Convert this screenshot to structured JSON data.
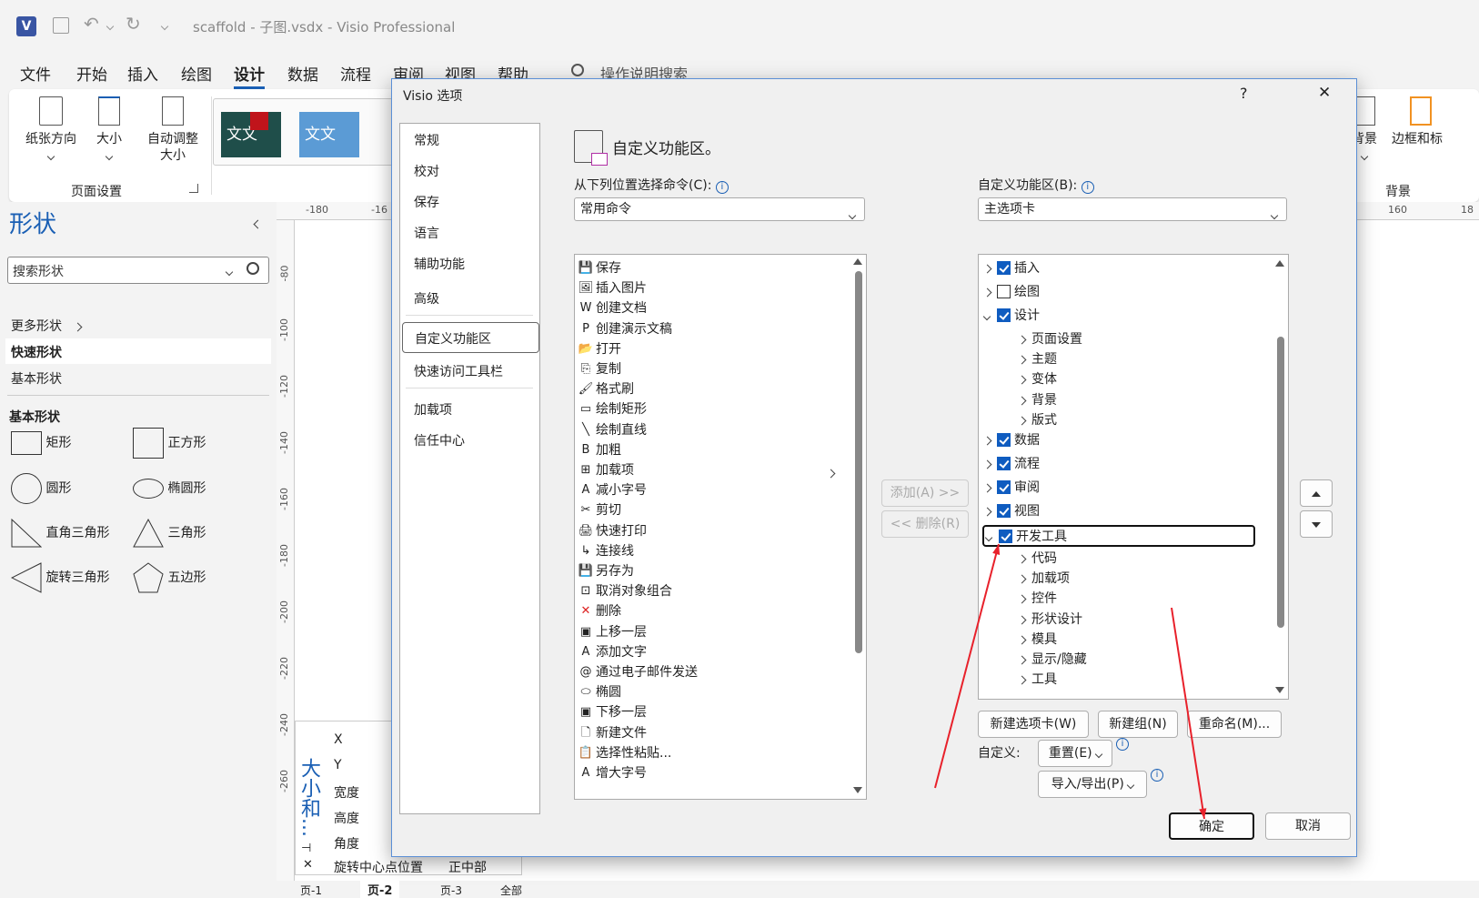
{
  "window": {
    "title": "scaffold - 子图.vsdx  -  Visio Professional",
    "app_icon": "visio-icon"
  },
  "menu": [
    "文件",
    "开始",
    "插入",
    "绘图",
    "设计",
    "数据",
    "流程",
    "审阅",
    "视图",
    "帮助"
  ],
  "menu_active": "设计",
  "tell_me": "操作说明搜索",
  "ribbon": {
    "page_setup": {
      "orientation": "纸张方向",
      "size": "大小",
      "auto_size_1": "自动调整",
      "auto_size_2": "大小",
      "group": "页面设置"
    },
    "theme_text": "文文",
    "background": {
      "bg": "背景",
      "border": "边框和标",
      "group": "背景"
    }
  },
  "shapes_panel": {
    "title": "形状",
    "search_placeholder": "搜索形状",
    "more": "更多形状",
    "quick": "快速形状",
    "basic": "基本形状",
    "section": "基本形状",
    "items": [
      "矩形",
      "正方形",
      "圆形",
      "椭圆形",
      "直角三角形",
      "三角形",
      "旋转三角形",
      "五边形"
    ]
  },
  "ruler": {
    "h": [
      "-180",
      "-16",
      "160",
      "18"
    ],
    "v": [
      "-80",
      "-100",
      "-120",
      "-140",
      "-160",
      "-180",
      "-200",
      "-220",
      "-240",
      "-260"
    ]
  },
  "sizepos": {
    "title": "大小和...",
    "rows": [
      "X",
      "Y",
      "宽度",
      "高度",
      "角度",
      "旋转中心点位置"
    ],
    "rot_value": "正中部"
  },
  "page_tabs": [
    "页-1",
    "页-2",
    "页-3",
    "全部"
  ],
  "dialog": {
    "title": "Visio 选项",
    "help": "?",
    "close": "✕",
    "nav": [
      "常规",
      "校对",
      "保存",
      "语言",
      "辅助功能",
      "高级",
      "自定义功能区",
      "快速访问工具栏",
      "加载项",
      "信任中心"
    ],
    "nav_selected": "自定义功能区",
    "heading": "自定义功能区。",
    "choose_label": "从下列位置选择命令(C):",
    "choose_value": "常用命令",
    "customize_label": "自定义功能区(B):",
    "customize_value": "主选项卡",
    "commands": [
      "保存",
      "插入图片",
      "创建文档",
      "创建演示文稿",
      "打开",
      "复制",
      "格式刷",
      "绘制矩形",
      "绘制直线",
      "加粗",
      "加载项",
      "减小字号",
      "剪切",
      "快速打印",
      "连接线",
      "另存为",
      "取消对象组合",
      "删除",
      "上移一层",
      "添加文字",
      "通过电子邮件发送",
      "椭圆",
      "下移一层",
      "新建文件",
      "选择性粘贴...",
      "增大字号"
    ],
    "add_btn": "添加(A) >>",
    "remove_btn": "<< 删除(R)",
    "tree": [
      {
        "label": "插入",
        "level": 0,
        "checked": true,
        "open": false
      },
      {
        "label": "绘图",
        "level": 0,
        "checked": false,
        "open": false
      },
      {
        "label": "设计",
        "level": 0,
        "checked": true,
        "open": true
      },
      {
        "label": "页面设置",
        "level": 1
      },
      {
        "label": "主题",
        "level": 1
      },
      {
        "label": "变体",
        "level": 1
      },
      {
        "label": "背景",
        "level": 1
      },
      {
        "label": "版式",
        "level": 1
      },
      {
        "label": "数据",
        "level": 0,
        "checked": true,
        "open": false
      },
      {
        "label": "流程",
        "level": 0,
        "checked": true,
        "open": false
      },
      {
        "label": "审阅",
        "level": 0,
        "checked": true,
        "open": false
      },
      {
        "label": "视图",
        "level": 0,
        "checked": true,
        "open": false
      },
      {
        "label": "开发工具",
        "level": 0,
        "checked": true,
        "open": true
      },
      {
        "label": "代码",
        "level": 1
      },
      {
        "label": "加载项",
        "level": 1
      },
      {
        "label": "控件",
        "level": 1
      },
      {
        "label": "形状设计",
        "level": 1
      },
      {
        "label": "模具",
        "level": 1
      },
      {
        "label": "显示/隐藏",
        "level": 1
      },
      {
        "label": "工具",
        "level": 1
      }
    ],
    "new_tab": "新建选项卡(W)",
    "new_group": "新建组(N)",
    "rename": "重命名(M)...",
    "customize_text": "自定义:",
    "reset": "重置(E)",
    "import_export": "导入/导出(P)",
    "ok": "确定",
    "cancel": "取消",
    "annotation_color": "#e8212b"
  }
}
